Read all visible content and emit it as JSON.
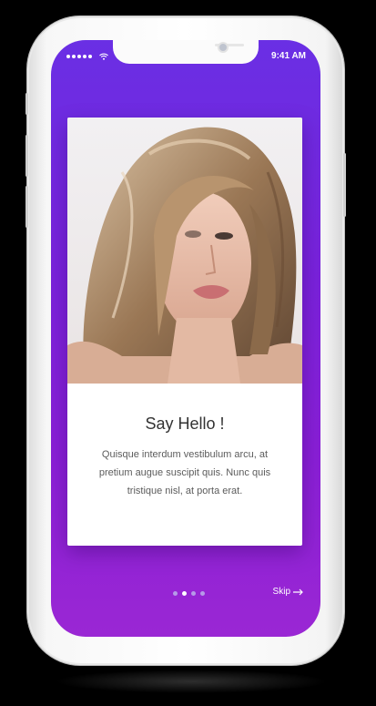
{
  "status_bar": {
    "time": "9:41 AM"
  },
  "onboarding": {
    "title": "Say Hello !",
    "description": "Quisque interdum vestibulum arcu, at pretium augue suscipit quis. Nunc quis tristique nisl, at porta erat.",
    "skip_label": "Skip",
    "current_page": 2,
    "total_pages": 4
  },
  "colors": {
    "gradient_top": "#6a2fe4",
    "gradient_bottom": "#9a27d4",
    "card": "#ffffff"
  },
  "icons": [
    "signal-dots-icon",
    "wifi-icon",
    "arrow-right-icon"
  ]
}
